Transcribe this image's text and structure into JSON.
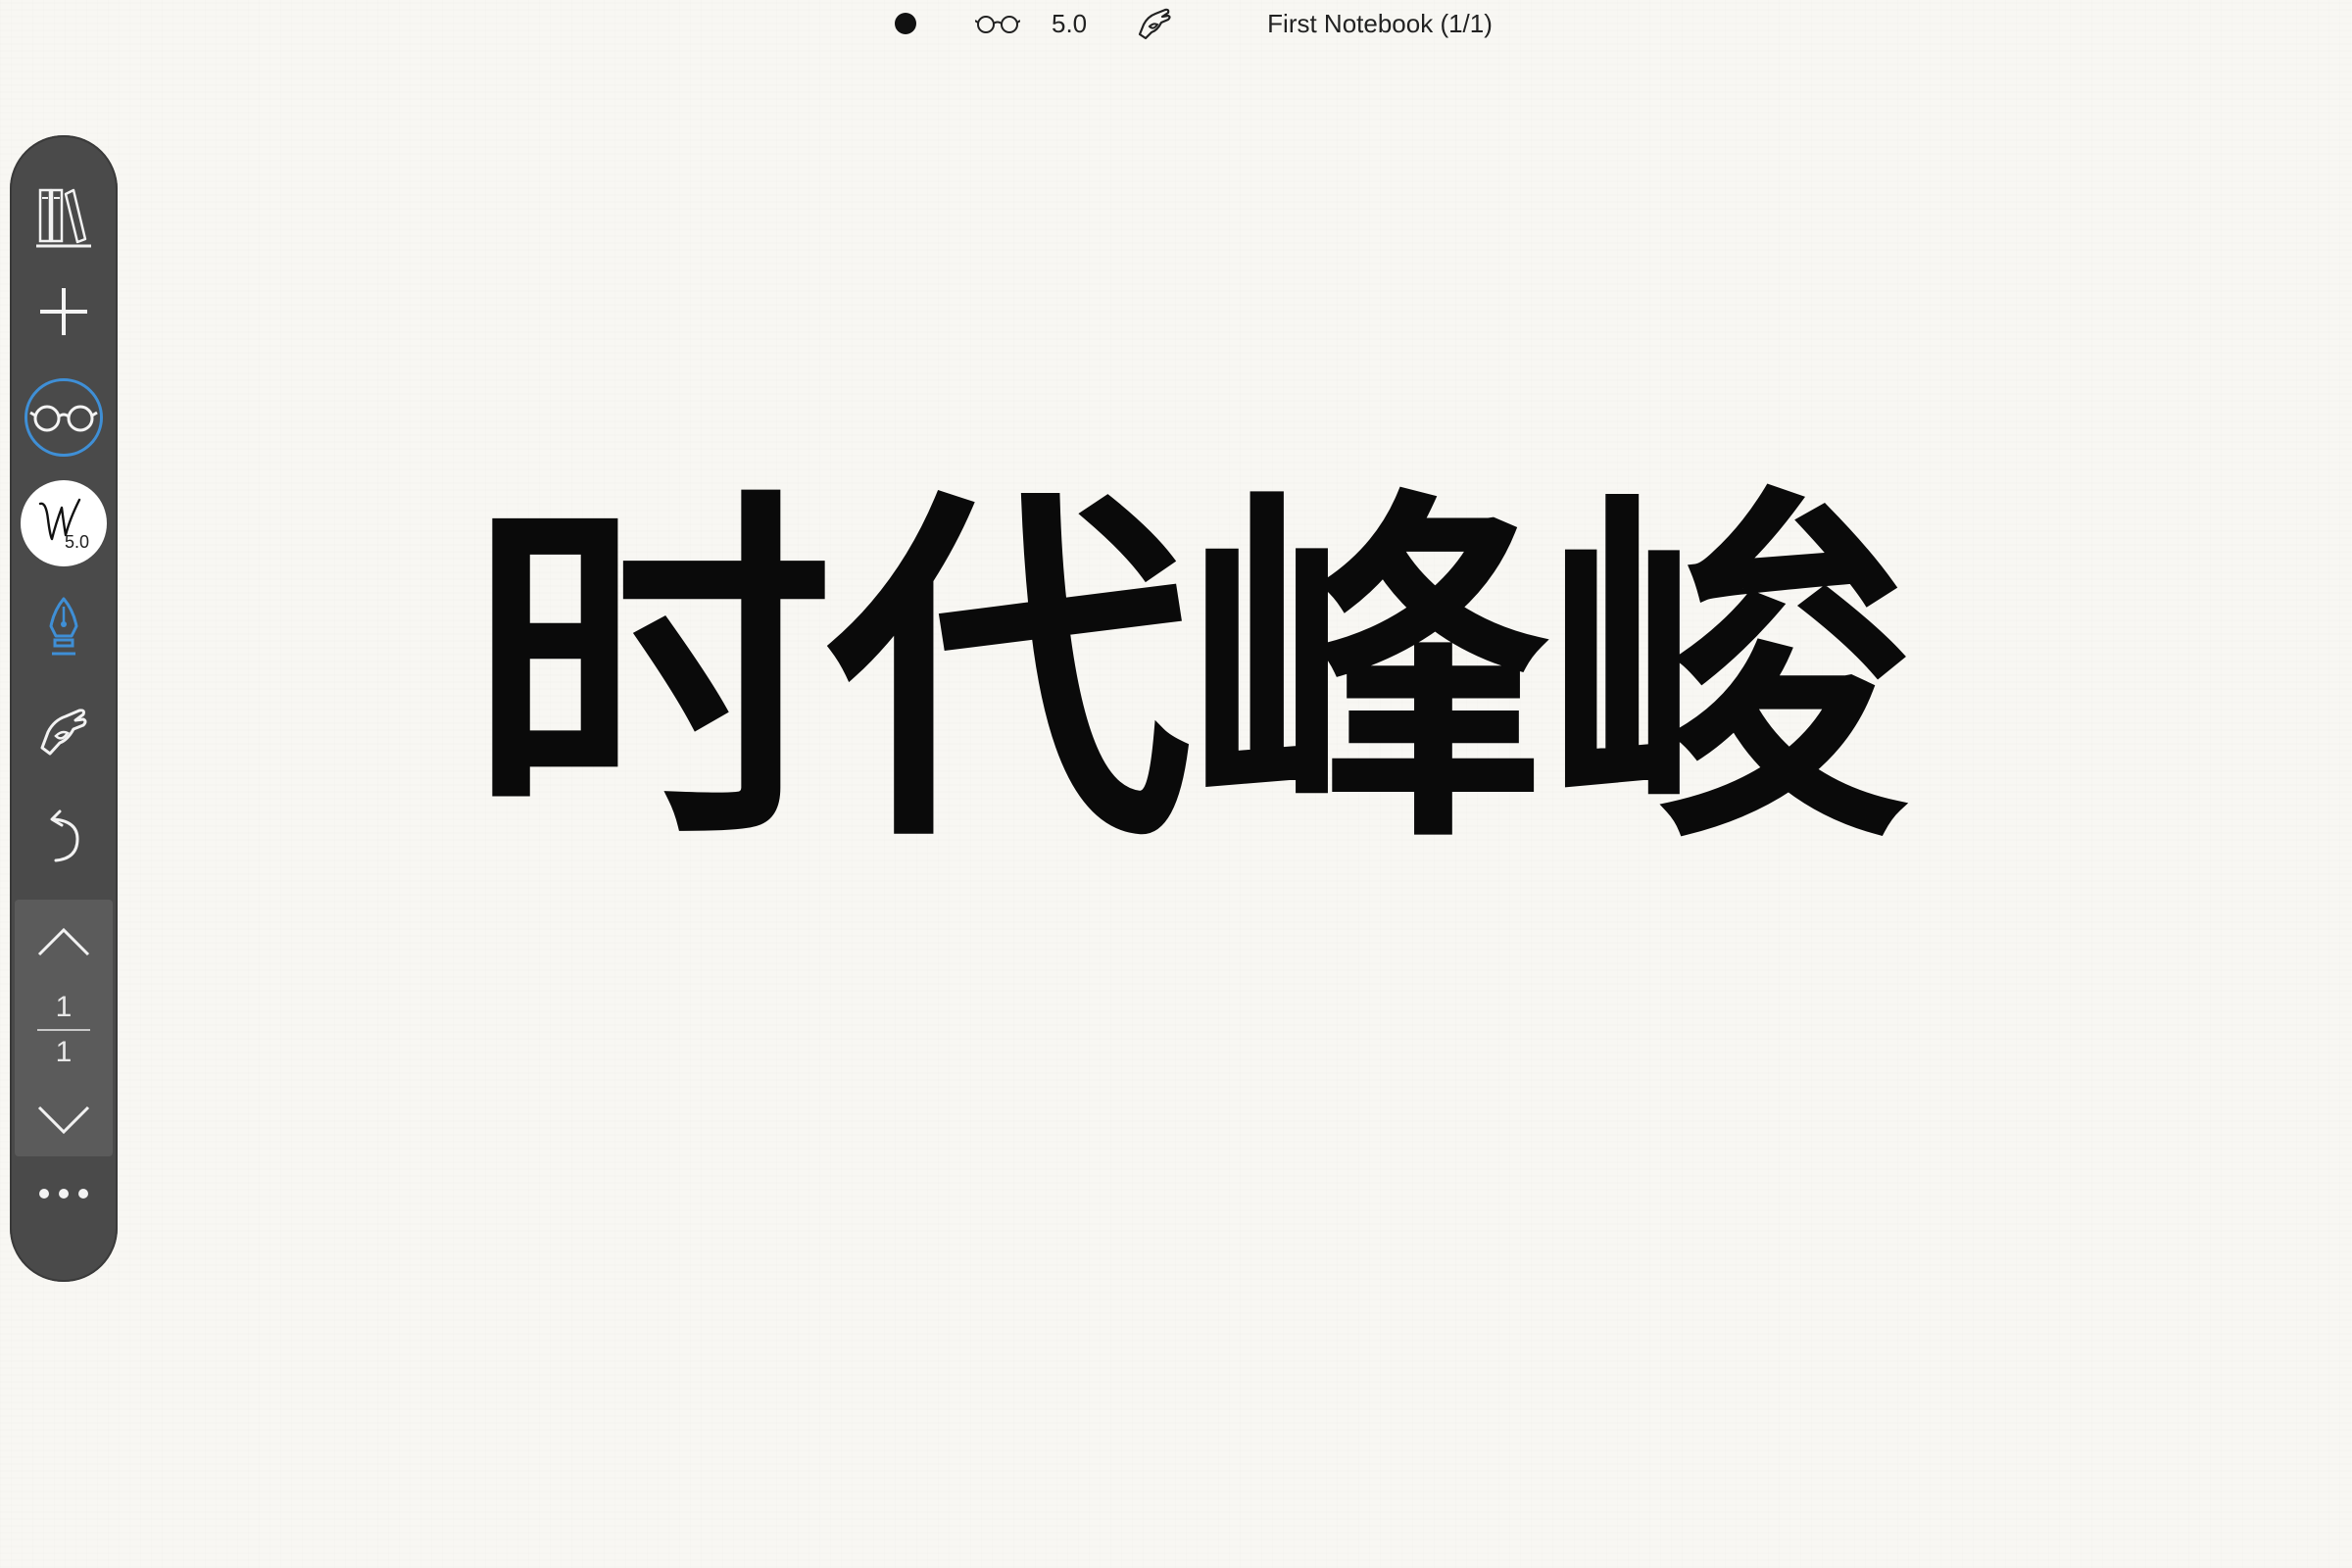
{
  "status_bar": {
    "pen_size": "5.0",
    "notebook_title": "First Notebook (1/1)"
  },
  "toolbar": {
    "pen_size_label": "5.0",
    "page_current": "1",
    "page_total": "1",
    "more_label": "•••"
  },
  "canvas": {
    "handwritten_text": "时代峰峻"
  },
  "colors": {
    "toolbar_bg": "#4a4a4a",
    "accent_blue": "#3f8fd6",
    "paper": "#f8f7f3",
    "ink": "#0a0a0a"
  },
  "icons": {
    "library": "library-books-icon",
    "add": "plus-icon",
    "reading_mode": "glasses-icon",
    "pen_size": "pen-size-icon",
    "pen": "fountain-pen-icon",
    "hand": "hand-icon",
    "undo": "undo-icon",
    "page_up": "chevron-up-icon",
    "page_down": "chevron-down-icon",
    "more": "more-icon"
  }
}
